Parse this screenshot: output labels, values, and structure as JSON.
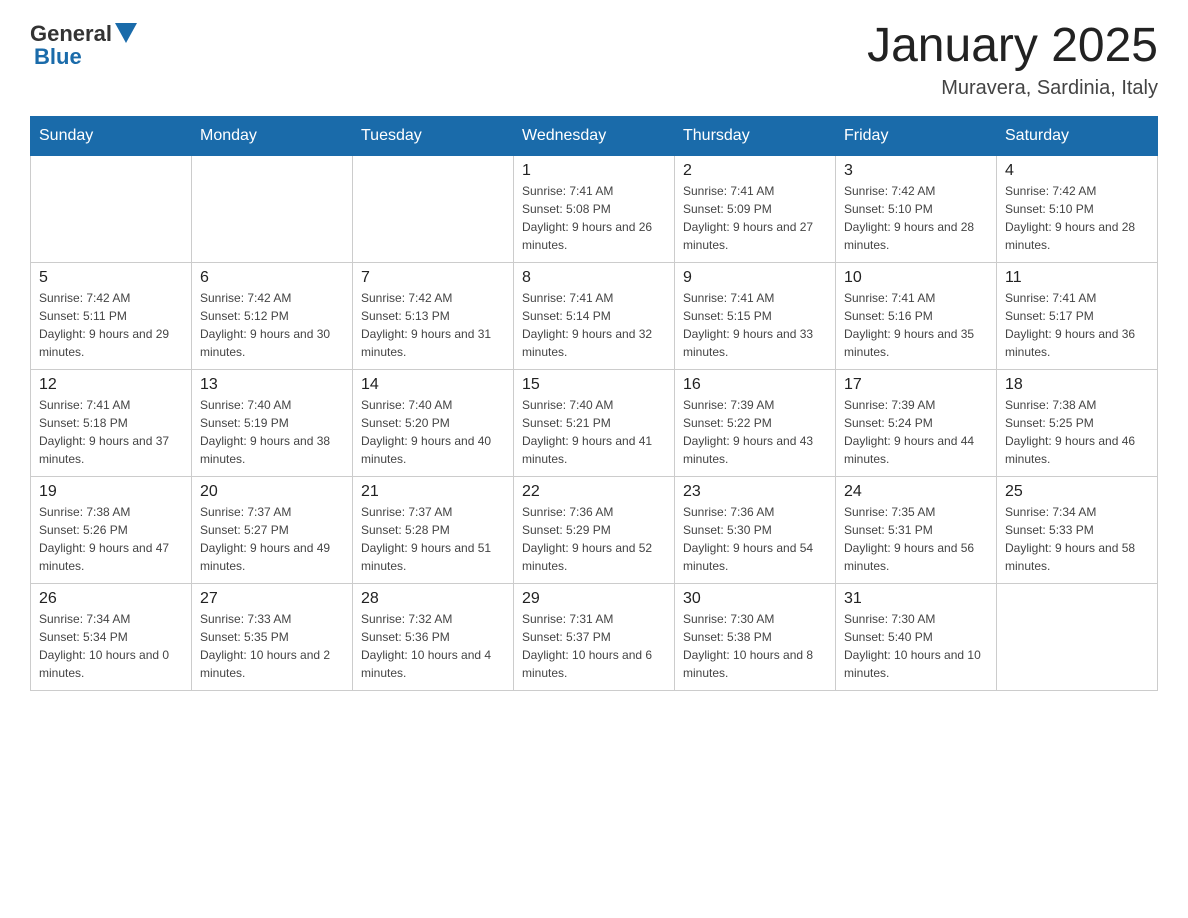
{
  "header": {
    "logo_general": "General",
    "logo_blue": "Blue",
    "title": "January 2025",
    "location": "Muravera, Sardinia, Italy"
  },
  "days_of_week": [
    "Sunday",
    "Monday",
    "Tuesday",
    "Wednesday",
    "Thursday",
    "Friday",
    "Saturday"
  ],
  "weeks": [
    [
      {
        "day": "",
        "info": ""
      },
      {
        "day": "",
        "info": ""
      },
      {
        "day": "",
        "info": ""
      },
      {
        "day": "1",
        "info": "Sunrise: 7:41 AM\nSunset: 5:08 PM\nDaylight: 9 hours and 26 minutes."
      },
      {
        "day": "2",
        "info": "Sunrise: 7:41 AM\nSunset: 5:09 PM\nDaylight: 9 hours and 27 minutes."
      },
      {
        "day": "3",
        "info": "Sunrise: 7:42 AM\nSunset: 5:10 PM\nDaylight: 9 hours and 28 minutes."
      },
      {
        "day": "4",
        "info": "Sunrise: 7:42 AM\nSunset: 5:10 PM\nDaylight: 9 hours and 28 minutes."
      }
    ],
    [
      {
        "day": "5",
        "info": "Sunrise: 7:42 AM\nSunset: 5:11 PM\nDaylight: 9 hours and 29 minutes."
      },
      {
        "day": "6",
        "info": "Sunrise: 7:42 AM\nSunset: 5:12 PM\nDaylight: 9 hours and 30 minutes."
      },
      {
        "day": "7",
        "info": "Sunrise: 7:42 AM\nSunset: 5:13 PM\nDaylight: 9 hours and 31 minutes."
      },
      {
        "day": "8",
        "info": "Sunrise: 7:41 AM\nSunset: 5:14 PM\nDaylight: 9 hours and 32 minutes."
      },
      {
        "day": "9",
        "info": "Sunrise: 7:41 AM\nSunset: 5:15 PM\nDaylight: 9 hours and 33 minutes."
      },
      {
        "day": "10",
        "info": "Sunrise: 7:41 AM\nSunset: 5:16 PM\nDaylight: 9 hours and 35 minutes."
      },
      {
        "day": "11",
        "info": "Sunrise: 7:41 AM\nSunset: 5:17 PM\nDaylight: 9 hours and 36 minutes."
      }
    ],
    [
      {
        "day": "12",
        "info": "Sunrise: 7:41 AM\nSunset: 5:18 PM\nDaylight: 9 hours and 37 minutes."
      },
      {
        "day": "13",
        "info": "Sunrise: 7:40 AM\nSunset: 5:19 PM\nDaylight: 9 hours and 38 minutes."
      },
      {
        "day": "14",
        "info": "Sunrise: 7:40 AM\nSunset: 5:20 PM\nDaylight: 9 hours and 40 minutes."
      },
      {
        "day": "15",
        "info": "Sunrise: 7:40 AM\nSunset: 5:21 PM\nDaylight: 9 hours and 41 minutes."
      },
      {
        "day": "16",
        "info": "Sunrise: 7:39 AM\nSunset: 5:22 PM\nDaylight: 9 hours and 43 minutes."
      },
      {
        "day": "17",
        "info": "Sunrise: 7:39 AM\nSunset: 5:24 PM\nDaylight: 9 hours and 44 minutes."
      },
      {
        "day": "18",
        "info": "Sunrise: 7:38 AM\nSunset: 5:25 PM\nDaylight: 9 hours and 46 minutes."
      }
    ],
    [
      {
        "day": "19",
        "info": "Sunrise: 7:38 AM\nSunset: 5:26 PM\nDaylight: 9 hours and 47 minutes."
      },
      {
        "day": "20",
        "info": "Sunrise: 7:37 AM\nSunset: 5:27 PM\nDaylight: 9 hours and 49 minutes."
      },
      {
        "day": "21",
        "info": "Sunrise: 7:37 AM\nSunset: 5:28 PM\nDaylight: 9 hours and 51 minutes."
      },
      {
        "day": "22",
        "info": "Sunrise: 7:36 AM\nSunset: 5:29 PM\nDaylight: 9 hours and 52 minutes."
      },
      {
        "day": "23",
        "info": "Sunrise: 7:36 AM\nSunset: 5:30 PM\nDaylight: 9 hours and 54 minutes."
      },
      {
        "day": "24",
        "info": "Sunrise: 7:35 AM\nSunset: 5:31 PM\nDaylight: 9 hours and 56 minutes."
      },
      {
        "day": "25",
        "info": "Sunrise: 7:34 AM\nSunset: 5:33 PM\nDaylight: 9 hours and 58 minutes."
      }
    ],
    [
      {
        "day": "26",
        "info": "Sunrise: 7:34 AM\nSunset: 5:34 PM\nDaylight: 10 hours and 0 minutes."
      },
      {
        "day": "27",
        "info": "Sunrise: 7:33 AM\nSunset: 5:35 PM\nDaylight: 10 hours and 2 minutes."
      },
      {
        "day": "28",
        "info": "Sunrise: 7:32 AM\nSunset: 5:36 PM\nDaylight: 10 hours and 4 minutes."
      },
      {
        "day": "29",
        "info": "Sunrise: 7:31 AM\nSunset: 5:37 PM\nDaylight: 10 hours and 6 minutes."
      },
      {
        "day": "30",
        "info": "Sunrise: 7:30 AM\nSunset: 5:38 PM\nDaylight: 10 hours and 8 minutes."
      },
      {
        "day": "31",
        "info": "Sunrise: 7:30 AM\nSunset: 5:40 PM\nDaylight: 10 hours and 10 minutes."
      },
      {
        "day": "",
        "info": ""
      }
    ]
  ]
}
